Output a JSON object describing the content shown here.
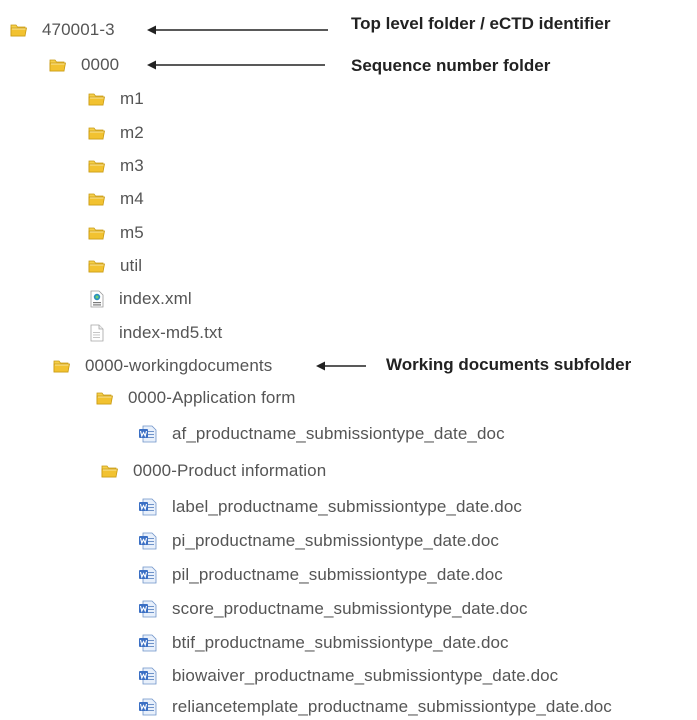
{
  "tree": {
    "root": "470001-3",
    "sequence": "0000",
    "modules": [
      "m1",
      "m2",
      "m3",
      "m4",
      "m5",
      "util"
    ],
    "files": [
      "index.xml",
      "index-md5.txt"
    ],
    "working": "0000-workingdocuments",
    "app_form": "0000-Application form",
    "app_form_doc": "af_productname_submissiontype_date_doc",
    "product_info": "0000-Product information",
    "product_docs": [
      "label_productname_submissiontype_date.doc",
      "pi_productname_submissiontype_date.doc",
      "pil_productname_submissiontype_date.doc",
      "score_productname_submissiontype_date.doc",
      "btif_productname_submissiontype_date.doc",
      "biowaiver_productname_submissiontype_date.doc",
      "reliancetemplate_productname_submissiontype_date.doc"
    ]
  },
  "annotations": {
    "top": "Top level folder / eCTD identifier",
    "sequence": "Sequence number folder",
    "working": "Working documents subfolder"
  },
  "colors": {
    "folder": "#f2c230",
    "folder_dark": "#c99a12",
    "text": "#555555",
    "annotation": "#222222",
    "doc_blue": "#3a6fc4"
  }
}
